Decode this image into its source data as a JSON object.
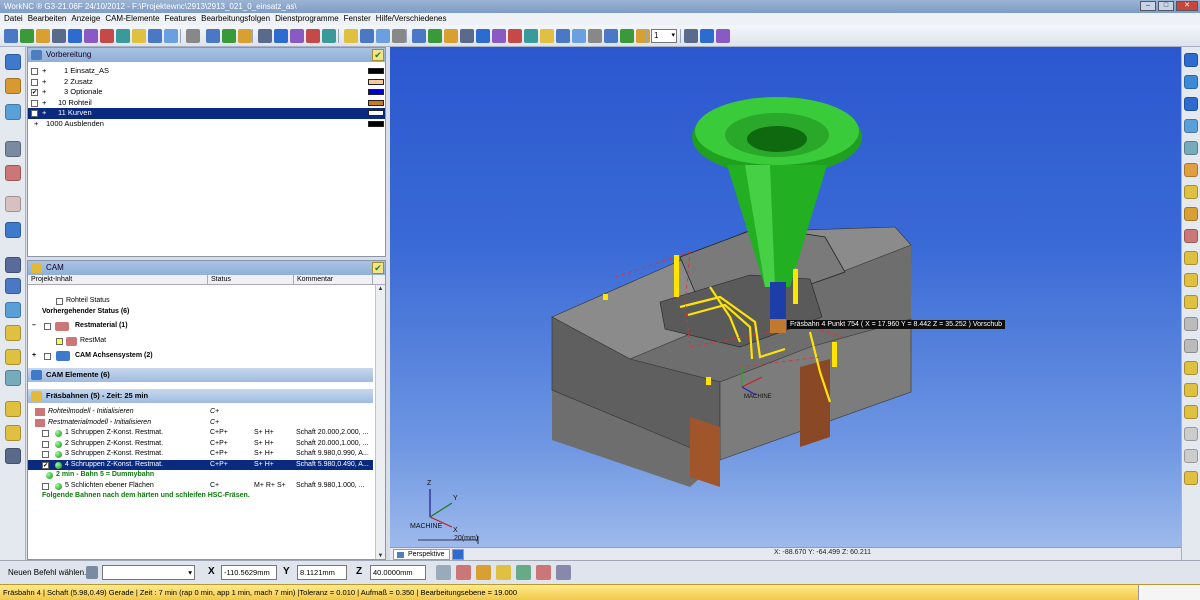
{
  "window": {
    "title": "WorkNC ® G3-21.06F  24/10/2012 - F:\\Projektewnc\\2913\\2913_021_0_einsatz_as\\"
  },
  "menu": [
    "Datei",
    "Bearbeiten",
    "Anzeige",
    "CAM-Elemente",
    "Features",
    "Bearbeitungsfolgen",
    "Dienstprogramme",
    "Fenster",
    "Hilfe/Verschiedenes"
  ],
  "toolbar": {
    "zoom_value": "1"
  },
  "vorbereitung": {
    "title": "Vorbereitung",
    "layers": [
      {
        "num_label": "1 Einsatz_AS",
        "checked": false,
        "color": "#000000"
      },
      {
        "num_label": "2 Zusatz",
        "checked": false,
        "color": "#f5c9a0"
      },
      {
        "num_label": "3 Optionale",
        "checked": true,
        "color": "#0000dd"
      },
      {
        "num_label": "10 Rohteil",
        "checked": false,
        "color": "#c8781e"
      },
      {
        "num_label": "11 Kurven",
        "checked": false,
        "color": "#ffffff",
        "selected": true
      },
      {
        "num_label": "1000 Ausblenden",
        "checked": false,
        "color": "#000000",
        "no_box": true
      }
    ]
  },
  "cam": {
    "title": "CAM",
    "columns": [
      "Projekt-Inhalt",
      "Status",
      "Kommentar"
    ],
    "items": {
      "rohteil_status": "Rohteil Status",
      "vorher_status": "Vorhergehender Status (6)",
      "restmaterial": "Restmaterial (1)",
      "restmat": "RestMat",
      "achsensystem": "CAM Achsensystem (2)"
    },
    "elements_bar": "CAM Elemente (6)",
    "paths_bar": "Fräsbahnen (5) - Zeit: 25 min",
    "paths": [
      {
        "name": "Rohteilmodell - Initialisieren",
        "status": "C+",
        "s": "",
        "comment": "",
        "kind": "init"
      },
      {
        "name": "Restmaterialmodell - Initialisieren",
        "status": "C+",
        "s": "",
        "comment": "",
        "kind": "init"
      },
      {
        "name": "1 Schruppen Z-Konst. Restmat.",
        "status": "C+P+",
        "s": "S+ H+",
        "comment": "Schaft 20.000,2.000, ...",
        "kind": "path"
      },
      {
        "name": "2 Schruppen Z-Konst. Restmat.",
        "status": "C+P+",
        "s": "S+ H+",
        "comment": "Schaft 20.000,1.000, ...",
        "kind": "path"
      },
      {
        "name": "3 Schruppen Z-Konst. Restmat.",
        "status": "C+P+",
        "s": "S+ H+",
        "comment": "Schaft 9.980,0.990, A...",
        "kind": "path"
      },
      {
        "name": "4 Schruppen Z-Konst. Restmat.",
        "status": "C+P+",
        "s": "S+ H+",
        "comment": "Schaft 5.980,0.490, A...",
        "kind": "path",
        "selected": true
      },
      {
        "name": "2 min - Bahn 5 = Dummybahn",
        "status": "",
        "s": "",
        "comment": "",
        "kind": "note"
      },
      {
        "name": "5 Schlichten ebener Flächen",
        "status": "C+",
        "s": "M+ R+ S+",
        "comment": "Schaft 9.980,1.000, ...",
        "kind": "path"
      },
      {
        "name": "Folgende Bahnen nach dem härten und schleifen HSC-Fräsen.",
        "status": "",
        "s": "",
        "comment": "",
        "kind": "greennote"
      }
    ]
  },
  "viewport": {
    "tooltip": "Fräsbahn 4 Punkt 754 ( X = 17.960  Y = 8.442  Z = 35.252 ) Vorschub",
    "triad_z": "Z",
    "triad_y": "Y",
    "triad_x": "X",
    "machine_label": "MACHINE",
    "machine_label_small": "MACHINE",
    "scale_label": "20(mm)",
    "tab": "Perspektive",
    "coords": "X: -88.670   Y: -64.499   Z: 60.211"
  },
  "command": {
    "label": "Neuen Befehl wählen...",
    "x_label": "X",
    "x_value": "-110.5629mm",
    "y_label": "Y",
    "y_value": "8.1121mm",
    "z_label": "Z",
    "z_value": "40.0000mm"
  },
  "status_bar": "Fräsbahn 4 | Schaft (5.98,0.49) Gerade | Zeit : 7 min (rap 0 min, app 1 min, mach 7 min) |Toleranz = 0.010 | Aufmaß = 0.350 | Bearbeitungsebene = 19.000",
  "colors": {
    "tool_green": "#2fbf2f",
    "tool_shank": "#1d3ea8",
    "block": "#7b7b7b",
    "toolpath_yellow": "#ffe400",
    "selection": "#0a2a80"
  }
}
